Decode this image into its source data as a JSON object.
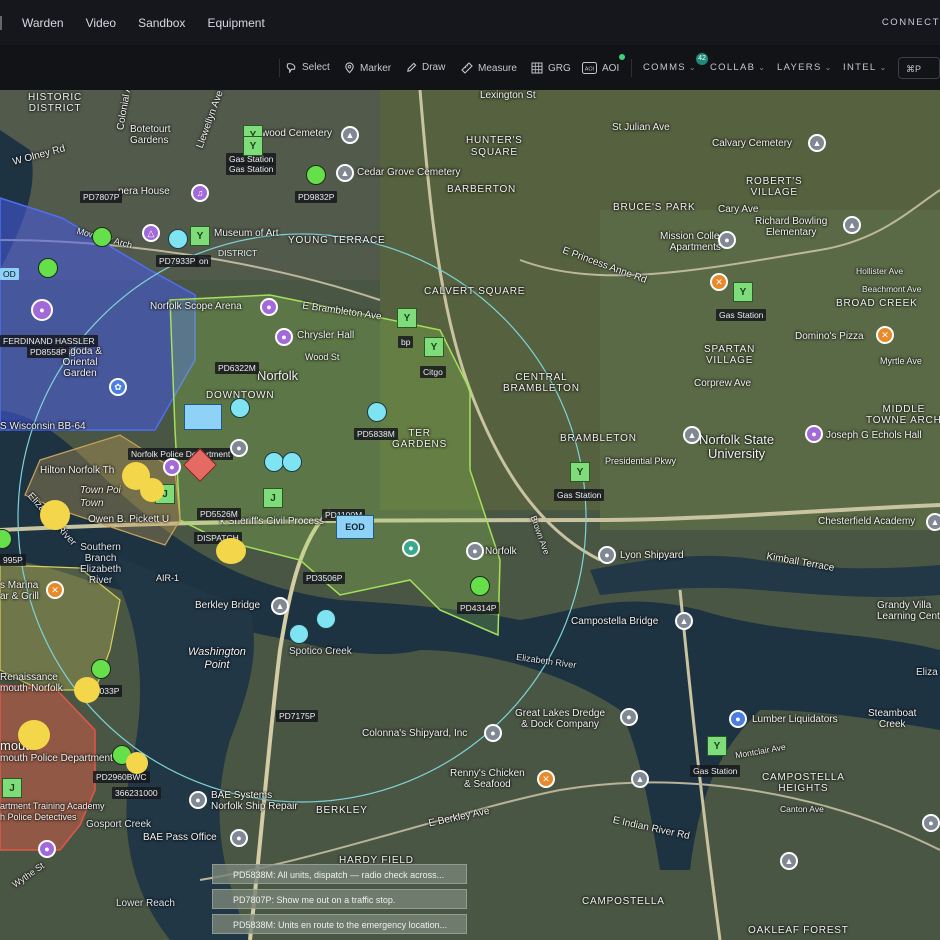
{
  "nav": {
    "items": [
      "Warden",
      "Video",
      "Sandbox",
      "Equipment"
    ],
    "connect_label": "CONNECT"
  },
  "toolbar": {
    "tools": [
      "Select",
      "Marker",
      "Draw",
      "Measure",
      "GRG",
      "AOI"
    ],
    "menus": [
      "COMMS",
      "COLLAB",
      "LAYERS",
      "INTEL"
    ],
    "collab_badge": "42",
    "p_button": "⌘P"
  },
  "map": {
    "places": [
      {
        "id": "historic-district",
        "text": "HISTORIC\nDISTRICT"
      },
      {
        "id": "colonial-ave",
        "text": "Colonial Av"
      },
      {
        "id": "botetourt-gardens",
        "text": "Botetourt\nGardens"
      },
      {
        "id": "llewellyn-ave",
        "text": "Llewellyn Ave"
      },
      {
        "id": "elmwood-cemetery",
        "text": "wood Cemetery"
      },
      {
        "id": "cedar-grove-cemetery",
        "text": "Cedar Grove Cemetery"
      },
      {
        "id": "lexington-st",
        "text": "Lexington St"
      },
      {
        "id": "hunters-square",
        "text": "HUNTER'S\nSQUARE"
      },
      {
        "id": "st-julian-ave",
        "text": "St Julian Ave"
      },
      {
        "id": "calvary-cemetery",
        "text": "Calvary Cemetery"
      },
      {
        "id": "roberts-village",
        "text": "ROBERT'S\nVILLAGE"
      },
      {
        "id": "barberton",
        "text": "BARBERTON"
      },
      {
        "id": "bruces-park",
        "text": "BRUCE'S PARK"
      },
      {
        "id": "cary-ave",
        "text": "Cary Ave"
      },
      {
        "id": "richard-bowling",
        "text": "Richard Bowling\nElementary"
      },
      {
        "id": "olney-rd",
        "text": "W Olney Rd"
      },
      {
        "id": "opera-house",
        "text": "pera House"
      },
      {
        "id": "museum-of-art",
        "text": "Museum of Art"
      },
      {
        "id": "young-terrace",
        "text": "YOUNG TERRACE"
      },
      {
        "id": "mission-college",
        "text": "Mission College\nApartments"
      },
      {
        "id": "princess-anne-rd",
        "text": "E Princess Anne Rd"
      },
      {
        "id": "hollister-ave",
        "text": "Hollister Ave"
      },
      {
        "id": "beachmont-ave",
        "text": "Beachmont Ave"
      },
      {
        "id": "broad-creek",
        "text": "BROAD CREEK"
      },
      {
        "id": "mowbray-arch",
        "text": "Mowbray Arch"
      },
      {
        "id": "calvert-square",
        "text": "CALVERT SQUARE"
      },
      {
        "id": "norfolk-scope",
        "text": "Norfolk Scope Arena"
      },
      {
        "id": "brambleton-ave",
        "text": "E Brambleton Ave"
      },
      {
        "id": "chrysler-hall",
        "text": "Chrysler Hall"
      },
      {
        "id": "spartan-village",
        "text": "SPARTAN\nVILLAGE"
      },
      {
        "id": "dominos",
        "text": "Domino's Pizza"
      },
      {
        "id": "myrtle-ave",
        "text": "Myrtle Ave"
      },
      {
        "id": "norfolk",
        "text": "Norfolk"
      },
      {
        "id": "wood-st",
        "text": "Wood St"
      },
      {
        "id": "central-brambleton",
        "text": "CENTRAL\nBRAMBLETON"
      },
      {
        "id": "corprew-ave",
        "text": "Corprew Ave"
      },
      {
        "id": "pagoda",
        "text": "Pagoda &\nOriental\nGarden"
      },
      {
        "id": "downtown",
        "text": "DOWNTOWN"
      },
      {
        "id": "middle-towne-arch",
        "text": "MIDDLE\nTOWNE ARCH"
      },
      {
        "id": "joseph-echols",
        "text": "Joseph G Echols Hall"
      },
      {
        "id": "wisconsin",
        "text": "S Wisconsin BB-64"
      },
      {
        "id": "harbor-gardens",
        "text": "TER\nGARDENS"
      },
      {
        "id": "norfolk-state",
        "text": "Norfolk State\nUniversity"
      },
      {
        "id": "brambleton",
        "text": "BRAMBLETON"
      },
      {
        "id": "presidential-pkwy",
        "text": "Presidential Pkwy"
      },
      {
        "id": "hilton",
        "text": "Hilton Norfolk Th"
      },
      {
        "id": "town-point",
        "text": "Town Poi\nTown"
      },
      {
        "id": "sheriff",
        "text": "k Sheriff's Civil Process"
      },
      {
        "id": "chesterfield",
        "text": "Chesterfield Academy"
      },
      {
        "id": "owen-pickett",
        "text": "Owen B. Pickett U"
      },
      {
        "id": "southern-branch",
        "text": "Southern\nBranch\nElizabeth\nRiver"
      },
      {
        "id": "elizabeth-river",
        "text": "Elizabeth River"
      },
      {
        "id": "lyon-shipyard",
        "text": "Lyon Shipyard"
      },
      {
        "id": "kimball-terrace",
        "text": "Kimball Terrace"
      },
      {
        "id": "norfolk-poi",
        "text": "Norfolk"
      },
      {
        "id": "brown-ave",
        "text": "Brown Ave"
      },
      {
        "id": "air-1",
        "text": "AIR-1"
      },
      {
        "id": "marina",
        "text": "s Marina\nar & Grill"
      },
      {
        "id": "berkley-bridge",
        "text": "Berkley Bridge"
      },
      {
        "id": "campostella-bridge",
        "text": "Campostella Bridge"
      },
      {
        "id": "grandy-village",
        "text": "Grandy Villa\nLearning Cent"
      },
      {
        "id": "washington-point",
        "text": "Washington\nPoint"
      },
      {
        "id": "spotico-creek",
        "text": "Spotico Creek"
      },
      {
        "id": "elizabeth-river-2",
        "text": "Elizabeth River"
      },
      {
        "id": "renaissance",
        "text": "Renaissance\nmouth-Norfolk"
      },
      {
        "id": "eliza",
        "text": "Eliza"
      },
      {
        "id": "great-lakes",
        "text": "Great Lakes Dredge\n& Dock Company"
      },
      {
        "id": "lumber-liquidators",
        "text": "Lumber Liquidators"
      },
      {
        "id": "steamboat-creek",
        "text": "Steamboat\nCreek"
      },
      {
        "id": "colonnas",
        "text": "Colonna's Shipyard, Inc"
      },
      {
        "id": "portsmouth",
        "text": "mouth"
      },
      {
        "id": "portsmouth-pd",
        "text": "mouth Police Department"
      },
      {
        "id": "campostella-heights",
        "text": "CAMPOSTELLA\nHEIGHTS"
      },
      {
        "id": "montclair-ave",
        "text": "Montclair Ave"
      },
      {
        "id": "rennys",
        "text": "Renny's Chicken\n& Seafood"
      },
      {
        "id": "bae-systems",
        "text": "BAE Systems\nNorfolk Ship Repair"
      },
      {
        "id": "berkley",
        "text": "BERKLEY"
      },
      {
        "id": "training-academy",
        "text": "artment Training Academy"
      },
      {
        "id": "police-detectives",
        "text": "h Police Detectives"
      },
      {
        "id": "gosport-creek",
        "text": "Gosport Creek"
      },
      {
        "id": "e-berkley-ave",
        "text": "E Berkley Ave"
      },
      {
        "id": "e-indian-river",
        "text": "E Indian River Rd"
      },
      {
        "id": "bae-pass-office",
        "text": "BAE Pass Office"
      },
      {
        "id": "hardy-field",
        "text": "HARDY FIELD"
      },
      {
        "id": "campostella",
        "text": "CAMPOSTELLA"
      },
      {
        "id": "oakleaf-forest",
        "text": "OAKLEAF FOREST"
      },
      {
        "id": "wythe-st",
        "text": "Wythe St"
      },
      {
        "id": "lower-reach",
        "text": "Lower Reach"
      },
      {
        "id": "canton-ave",
        "text": "Canton Ave"
      }
    ],
    "units": [
      {
        "id": "pd7807p",
        "text": "PD7807P"
      },
      {
        "id": "pd9832p",
        "text": "PD9832P"
      },
      {
        "id": "pd7933p",
        "text": "PD7933P"
      },
      {
        "id": "ferdinand",
        "text": "FERDINAND HASSLER"
      },
      {
        "id": "pd8558p",
        "text": "PD8558P"
      },
      {
        "id": "pd6322m",
        "text": "PD6322M"
      },
      {
        "id": "pd5838m",
        "text": "PD5838M"
      },
      {
        "id": "npd",
        "text": "Norfolk Police Department"
      },
      {
        "id": "pd5526m",
        "text": "PD5526M"
      },
      {
        "id": "pd1100m",
        "text": "PD1100M"
      },
      {
        "id": "dispatch",
        "text": "DISPATCH"
      },
      {
        "id": "pd3506p",
        "text": "PD3506P"
      },
      {
        "id": "pd4314p",
        "text": "PD4314P"
      },
      {
        "id": "pd0033p",
        "text": "PD0033P"
      },
      {
        "id": "pd7175p",
        "text": "PD7175P"
      },
      {
        "id": "pd2960bwc",
        "text": "PD2960BWC"
      },
      {
        "id": "unit-366231000",
        "text": "366231000"
      },
      {
        "id": "gas1",
        "text": "Gas Station"
      },
      {
        "id": "gas2",
        "text": "Gas Station"
      },
      {
        "id": "gas3",
        "text": "Gas Station"
      },
      {
        "id": "gas4",
        "text": "Gas Station"
      },
      {
        "id": "gas5",
        "text": "Gas Station"
      },
      {
        "id": "bp",
        "text": "bp"
      },
      {
        "id": "citgo",
        "text": "Citgo"
      },
      {
        "id": "od",
        "text": "OD"
      },
      {
        "id": "p995",
        "text": "995P"
      },
      {
        "id": "district",
        "text": "DISTRICT"
      },
      {
        "id": "on",
        "text": "on"
      },
      {
        "id": "eod",
        "text": "EOD"
      }
    ],
    "toasts": [
      "PD5838M: All units, dispatch — radio check across...",
      "PD7807P: Show me out on a traffic stop.",
      "PD5838M: Units en route to the emergency location..."
    ]
  }
}
